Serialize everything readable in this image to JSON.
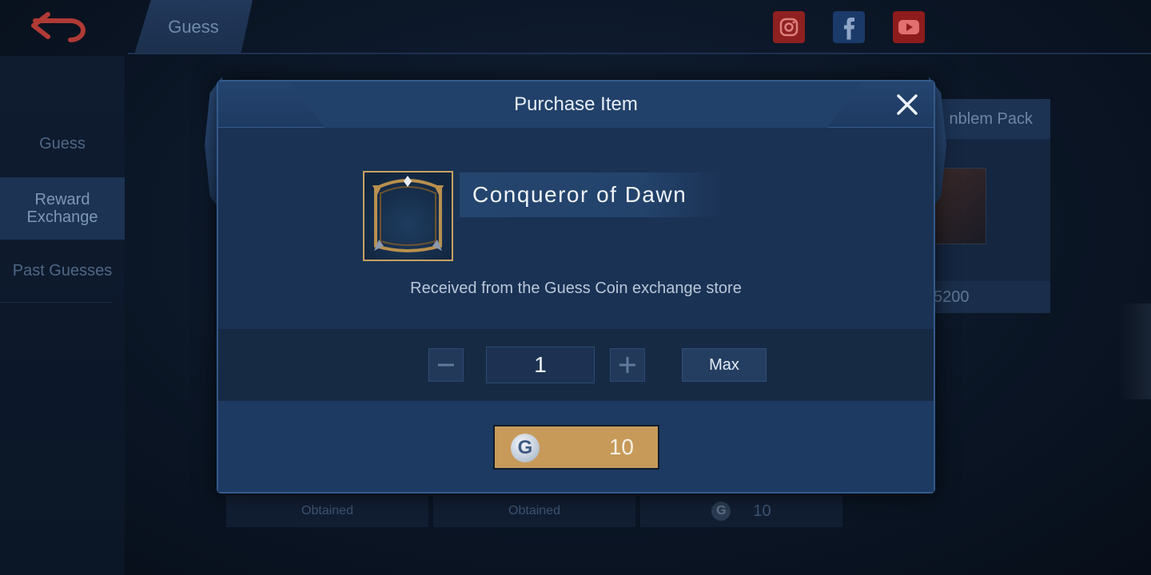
{
  "background": {
    "top_tab_label": "Guess",
    "sidebar": {
      "items": [
        {
          "label": "Guess"
        },
        {
          "label": "Reward Exchange"
        },
        {
          "label": "Past Guesses"
        }
      ]
    },
    "card": {
      "title": "nblem Pack",
      "price": "5200"
    },
    "row": {
      "cell1": "Obtained",
      "cell2": "Obtained",
      "cell3_coin": "G",
      "cell3_price": "10"
    },
    "social_icons": [
      "instagram-icon",
      "facebook-icon",
      "youtube-icon"
    ]
  },
  "modal": {
    "title": "Purchase Item",
    "item": {
      "name": "Conqueror of Dawn",
      "description": "Received from the Guess Coin exchange store"
    },
    "quantity": {
      "value": "1",
      "max_label": "Max"
    },
    "purchase": {
      "coin_symbol": "G",
      "price": "10"
    }
  },
  "colors": {
    "accent_gold": "#c79a5a",
    "frame_gold": "#c7a160",
    "modal_blue": "#1b355a"
  }
}
